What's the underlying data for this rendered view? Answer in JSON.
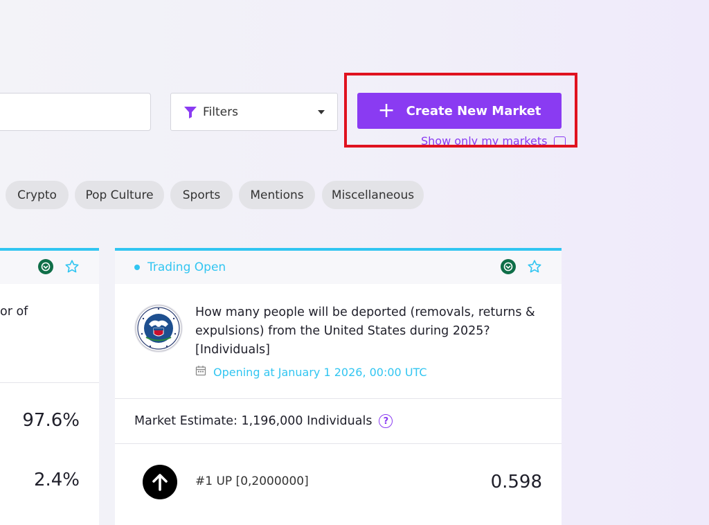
{
  "toolbar": {
    "filters_label": "Filters",
    "create_market_label": "Create New Market",
    "show_only_my_markets": "Show only my markets"
  },
  "tags": [
    "Crypto",
    "Pop Culture",
    "Sports",
    "Mentions",
    "Miscellaneous"
  ],
  "left_card": {
    "question_fragment": "or of",
    "values": [
      "97.6%",
      "2.4%"
    ]
  },
  "market_card": {
    "status": "Trading Open",
    "question": "How many people will be deported (removals, returns & expulsions) from the United States during 2025? [Individuals]",
    "opening": "Opening at January 1 2026, 00:00 UTC",
    "estimate": "Market Estimate: 1,196,000 Individuals",
    "outcome": {
      "label": "#1 UP [0,2000000]",
      "value": "0.598"
    }
  },
  "colors": {
    "accent": "#8a3bf2",
    "status": "#31c5f1",
    "highlight": "#e0121f"
  }
}
